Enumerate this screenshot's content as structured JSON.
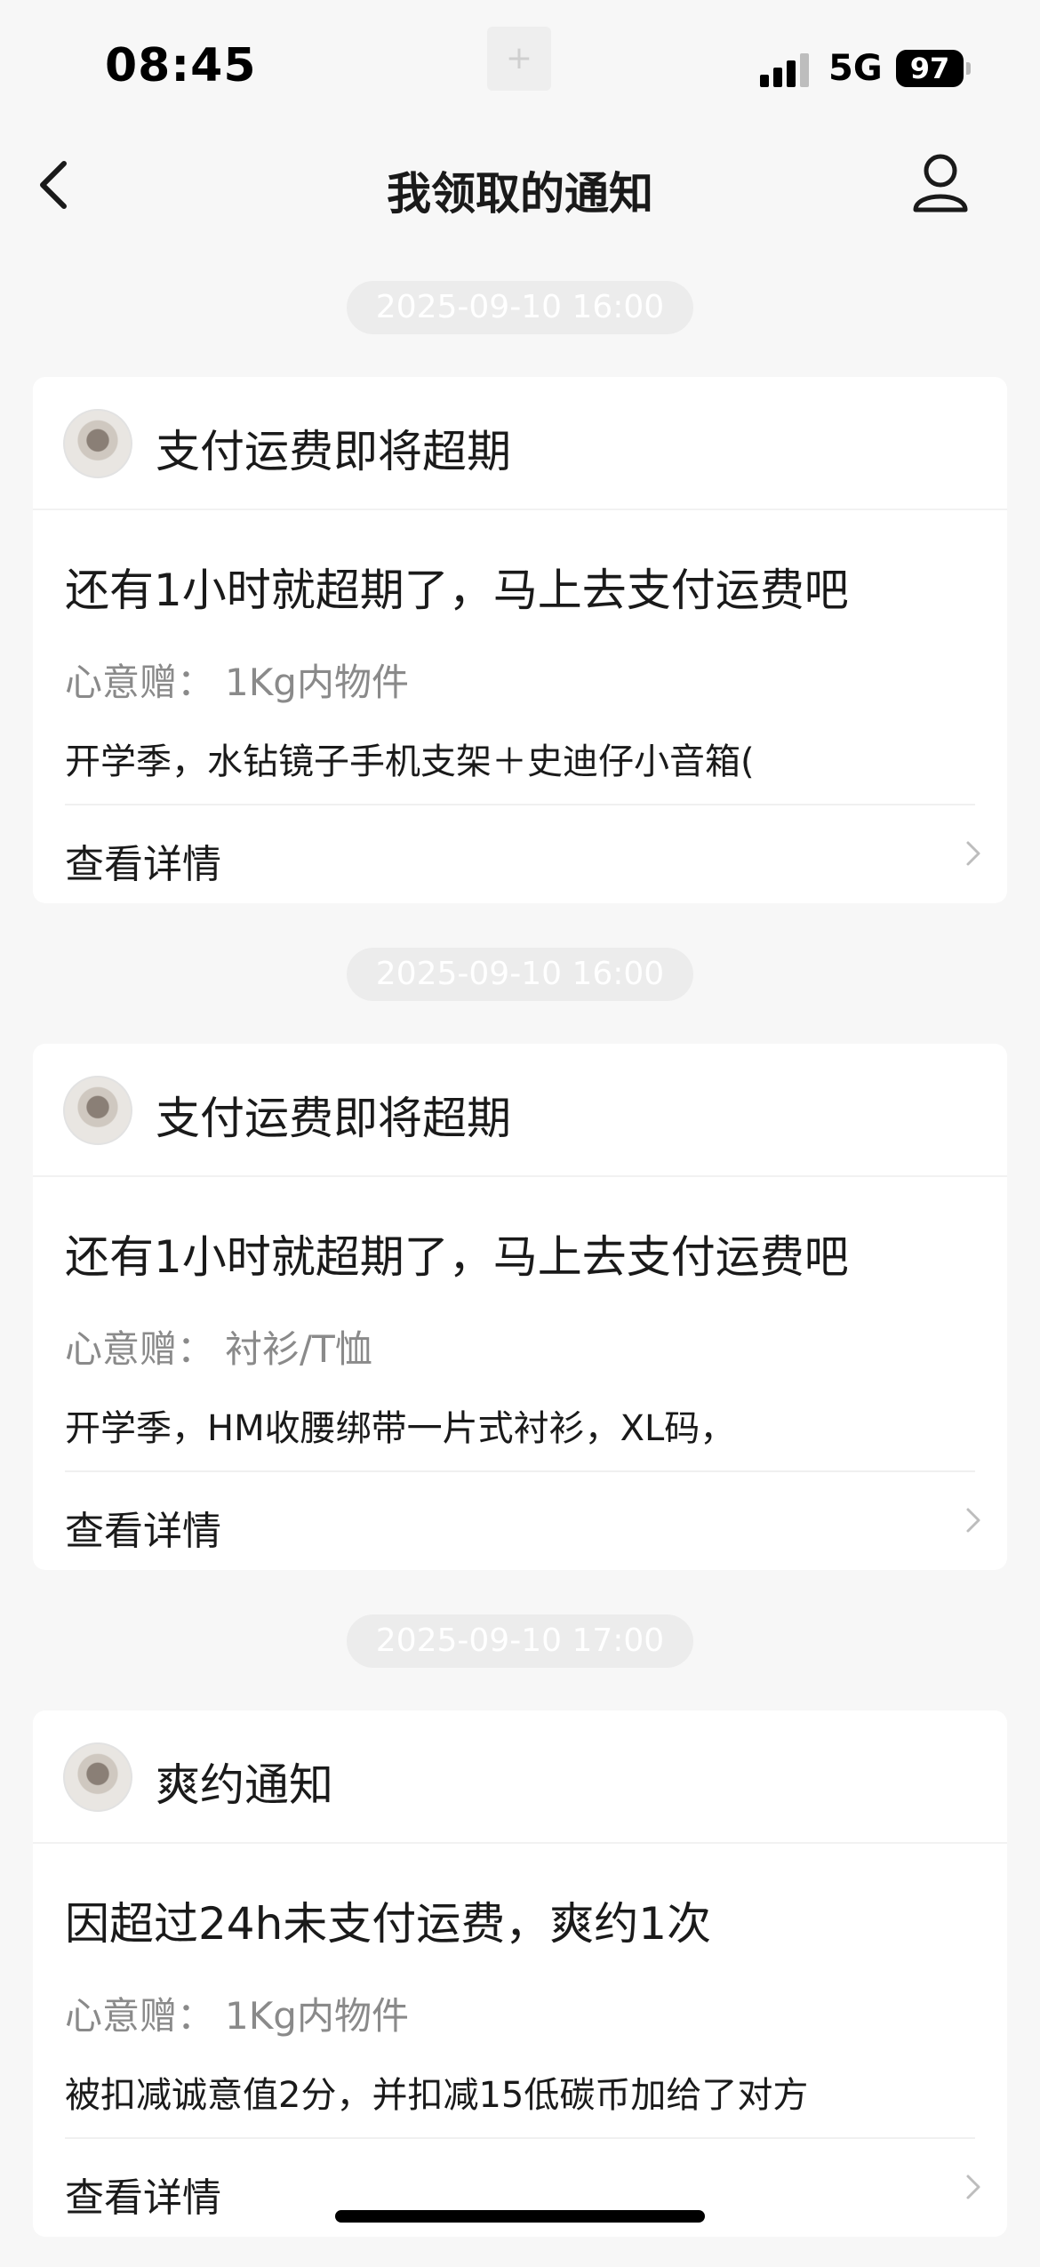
{
  "status_bar": {
    "time": "08:45",
    "center_glyph": "+",
    "network": "5G",
    "battery": "97"
  },
  "nav": {
    "title": "我领取的通知",
    "back_icon": "chevron-left-icon",
    "profile_icon": "user-icon"
  },
  "notifications": [
    {
      "timestamp": "2025-09-10 16:00",
      "title": "支付运费即将超期",
      "message": "还有1小时就超期了，马上去支付运费吧",
      "gift_label": "心意赠：",
      "gift_value": "1Kg内物件",
      "description": "开学季，水钻镜子手机支架＋史迪仔小音箱(",
      "detail_label": "查看详情"
    },
    {
      "timestamp": "2025-09-10 16:00",
      "title": "支付运费即将超期",
      "message": "还有1小时就超期了，马上去支付运费吧",
      "gift_label": "心意赠：",
      "gift_value": "衬衫/T恤",
      "description": "开学季，HM收腰绑带一片式衬衫，XL码，",
      "detail_label": "查看详情"
    },
    {
      "timestamp": "2025-09-10 17:00",
      "title": "爽约通知",
      "message": "因超过24h未支付运费，爽约1次",
      "gift_label": "心意赠：",
      "gift_value": "1Kg内物件",
      "description": "被扣减诚意值2分，并扣减15低碳币加给了对方",
      "detail_label": "查看详情"
    }
  ]
}
